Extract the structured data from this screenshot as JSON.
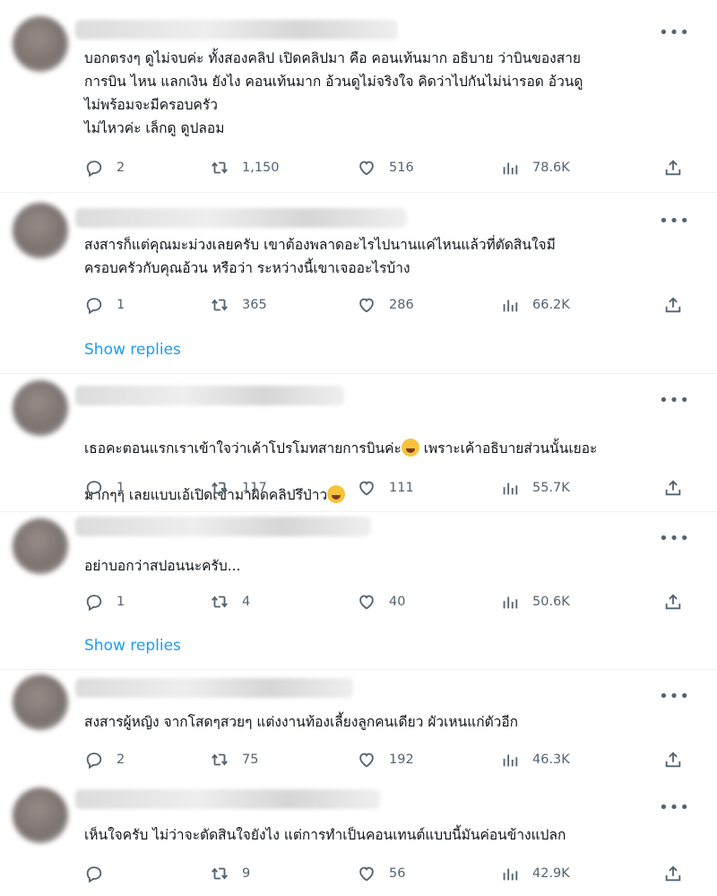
{
  "tweets": [
    {
      "text": "บอกตรงๆ ดูไม่จบค่ะ ทั้งสองคลิป เปิดคลิปมา คือ คอนเท้นมาก อธิบาย ว่าบินของสาย\nการบิน ไหน แลกเงิน ยังไง คอนเท้นมาก อ้วนดูไม่จริงใจ คิดว่าไปกันไม่น่ารอด อ้วนดู\nไม่พร้อมจะมีครอบครัว\nไม่ไหวค่ะ เล็กดู ดูปลอม",
      "replies": "2",
      "retweets": "1,150",
      "likes": "516",
      "views": "78.6K"
    },
    {
      "text": "สงสารก็แต่คุณมะม่วงเลยครับ เขาต้องพลาดอะไรไปนานแค่ไหนแล้วที่ตัดสินใจมี\nครอบครัวกับคุณอ้วน หรือว่า ระหว่างนี้เขาเจออะไรบ้าง",
      "replies": "1",
      "retweets": "365",
      "likes": "286",
      "views": "66.2K",
      "show_replies": "Show replies"
    },
    {
      "text_line1": "เธอคะตอนแรกเราเข้าใจว่าเค้าโปรโมทสายการบินค่ะ",
      "text_line1b": " เพราะเค้าอธิบายส่วนนั้นเยอะ",
      "text_line2": "มากๆๆ เลยแบบเอ้เปิดเข้ามาผิดคลิปรึป่าว",
      "replies": "1",
      "retweets": "117",
      "likes": "111",
      "views": "55.7K"
    },
    {
      "text": "อย่าบอกว่าสปอนนะครับ...",
      "replies": "1",
      "retweets": "4",
      "likes": "40",
      "views": "50.6K",
      "show_replies": "Show replies"
    },
    {
      "text": "สงสารผู้หญิง จากโสดๆสวยๆ แต่งงานท้องเลี้ยงลูกคนเดียว ผัวเหนแก่ตัวอีก",
      "replies": "2",
      "retweets": "75",
      "likes": "192",
      "views": "46.3K"
    },
    {
      "text": "เห็นใจครับ ไม่ว่าจะตัดสินใจยังไง แต่การทำเป็นคอนเทนต์แบบนี้มันค่อนข้างแปลก",
      "replies": "",
      "retweets": "9",
      "likes": "56",
      "views": "42.9K"
    }
  ],
  "icons": {
    "reply": "reply-icon",
    "retweet": "retweet-icon",
    "like": "heart-icon",
    "views": "views-icon",
    "share": "share-icon",
    "more": "more-icon",
    "emoji": "face-with-tears-of-joy-emoji"
  },
  "more_label": "•••",
  "colors": {
    "text": "#0f1419",
    "muted": "#536471",
    "link": "#1d9bf0",
    "divider": "#eff3f4"
  }
}
